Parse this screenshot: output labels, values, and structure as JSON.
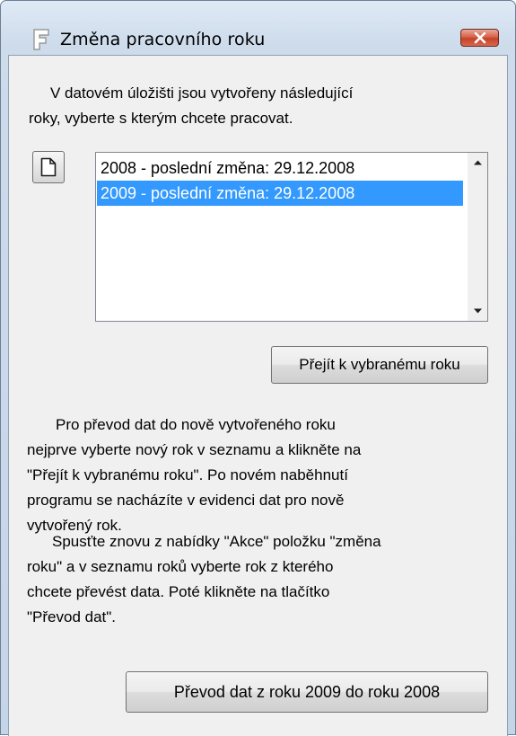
{
  "window": {
    "title": "Změna pracovního roku",
    "app_icon": "letter-f-icon",
    "close_icon": "close-icon"
  },
  "intro": {
    "line1": "V datovém úložišti jsou vytvořeny následující",
    "line2": "roky, vyberte s kterým chcete pracovat."
  },
  "new_button": {
    "icon": "new-document-icon"
  },
  "years_list": {
    "items": [
      {
        "label": "2008 - poslední změna: 29.12.2008",
        "selected": false
      },
      {
        "label": "2009 - poslední změna: 29.12.2008",
        "selected": true
      }
    ],
    "scroll_up_icon": "scroll-up-arrow-icon",
    "scroll_down_icon": "scroll-down-arrow-icon"
  },
  "goto_button": {
    "label": "Přejít k vybranému roku"
  },
  "instructions": {
    "para1": [
      "Pro převod dat do nově vytvořeného roku",
      "nejprve vyberte nový rok v seznamu a klikněte na",
      "\"Přejít k vybranému roku\". Po novém naběhnutí",
      "programu se nacházíte v evidenci dat pro nově",
      "vytvořený  rok."
    ],
    "para2": [
      "Spusťte znovu z nabídky \"Akce\" položku \"změna",
      "roku\" a v seznamu roků vyberte rok z kterého",
      "chcete převést data. Poté klikněte na tlačítko",
      "\"Převod dat\"."
    ]
  },
  "transfer_button": {
    "label": "Převod dat z roku 2009 do roku 2008"
  },
  "colors": {
    "selection": "#3399ff",
    "close_button": "#c7412a",
    "dialog_background": "#f0f0f0"
  }
}
